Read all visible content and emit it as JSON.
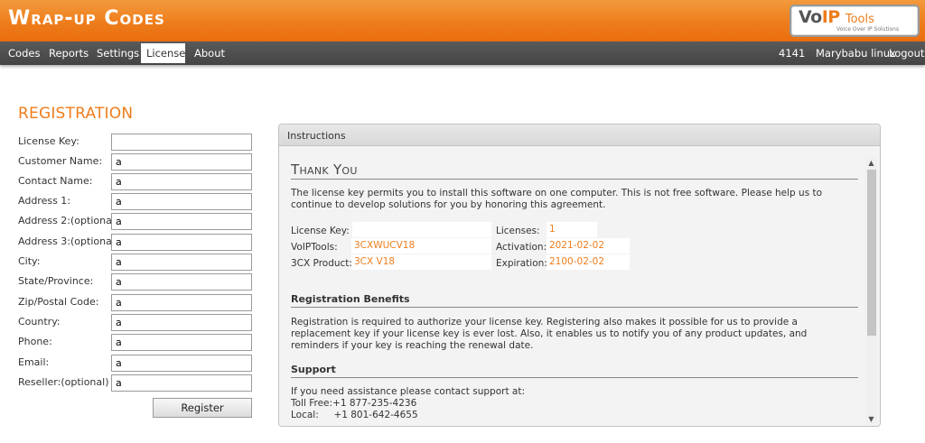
{
  "app": {
    "title": "Wrap-up Codes"
  },
  "logo": {
    "vo": "Vo",
    "ip": "IP",
    "tools": "Tools",
    "tagline": "Voice Over IP Solutions"
  },
  "nav": {
    "items": [
      "Codes",
      "Reports",
      "Settings",
      "License",
      "About"
    ],
    "active": "License",
    "extension": "4141",
    "user": "Marybabu linux",
    "logout": "Logout"
  },
  "registration": {
    "title": "REGISTRATION",
    "fields": [
      {
        "label": "License Key:",
        "value": ""
      },
      {
        "label": "Customer Name:",
        "value": "a"
      },
      {
        "label": "Contact Name:",
        "value": "a"
      },
      {
        "label": "Address 1:",
        "value": "a"
      },
      {
        "label": "Address 2:(optional)",
        "value": "a"
      },
      {
        "label": "Address 3:(optional)",
        "value": "a"
      },
      {
        "label": "City:",
        "value": "a"
      },
      {
        "label": "State/Province:",
        "value": "a"
      },
      {
        "label": "Zip/Postal Code:",
        "value": "a"
      },
      {
        "label": "Country:",
        "value": "a"
      },
      {
        "label": "Phone:",
        "value": "a"
      },
      {
        "label": "Email:",
        "value": "a"
      },
      {
        "label": "Reseller:(optional)",
        "value": "a"
      }
    ],
    "register_label": "Register"
  },
  "instructions": {
    "header": "Instructions",
    "thank_you": "Thank You",
    "intro": "The license key permits you to install this software on one computer. This is not free software. Please help us to continue to develop solutions for you by honoring this agreement.",
    "license_info": {
      "license_key_label": "License Key:",
      "license_key_value": "",
      "voiptools_label": "VoIPTools:",
      "voiptools_value": "3CXWUCV18",
      "product_label": "3CX Product:",
      "product_value": "3CX V18",
      "licenses_label": "Licenses:",
      "licenses_value": "1",
      "activation_label": "Activation:",
      "activation_value": "2021-02-02",
      "expiration_label": "Expiration:",
      "expiration_value": "2100-02-02"
    },
    "benefits_title": "Registration Benefits",
    "benefits_text": "Registration is required to authorize your license key. Registering also makes it possible for us to provide a replacement key if your license key is ever lost. Also, it enables us to notify you of any product updates, and reminders if your key is reaching the renewal date.",
    "support_title": "Support",
    "support_intro": "If you need assistance please contact support at:",
    "toll_free": "Toll Free:+1 877-235-4236",
    "local": "Local:     +1 801-642-4655"
  },
  "colors": {
    "accent": "#ee7d1c",
    "navbar": "#4a4a4a"
  }
}
